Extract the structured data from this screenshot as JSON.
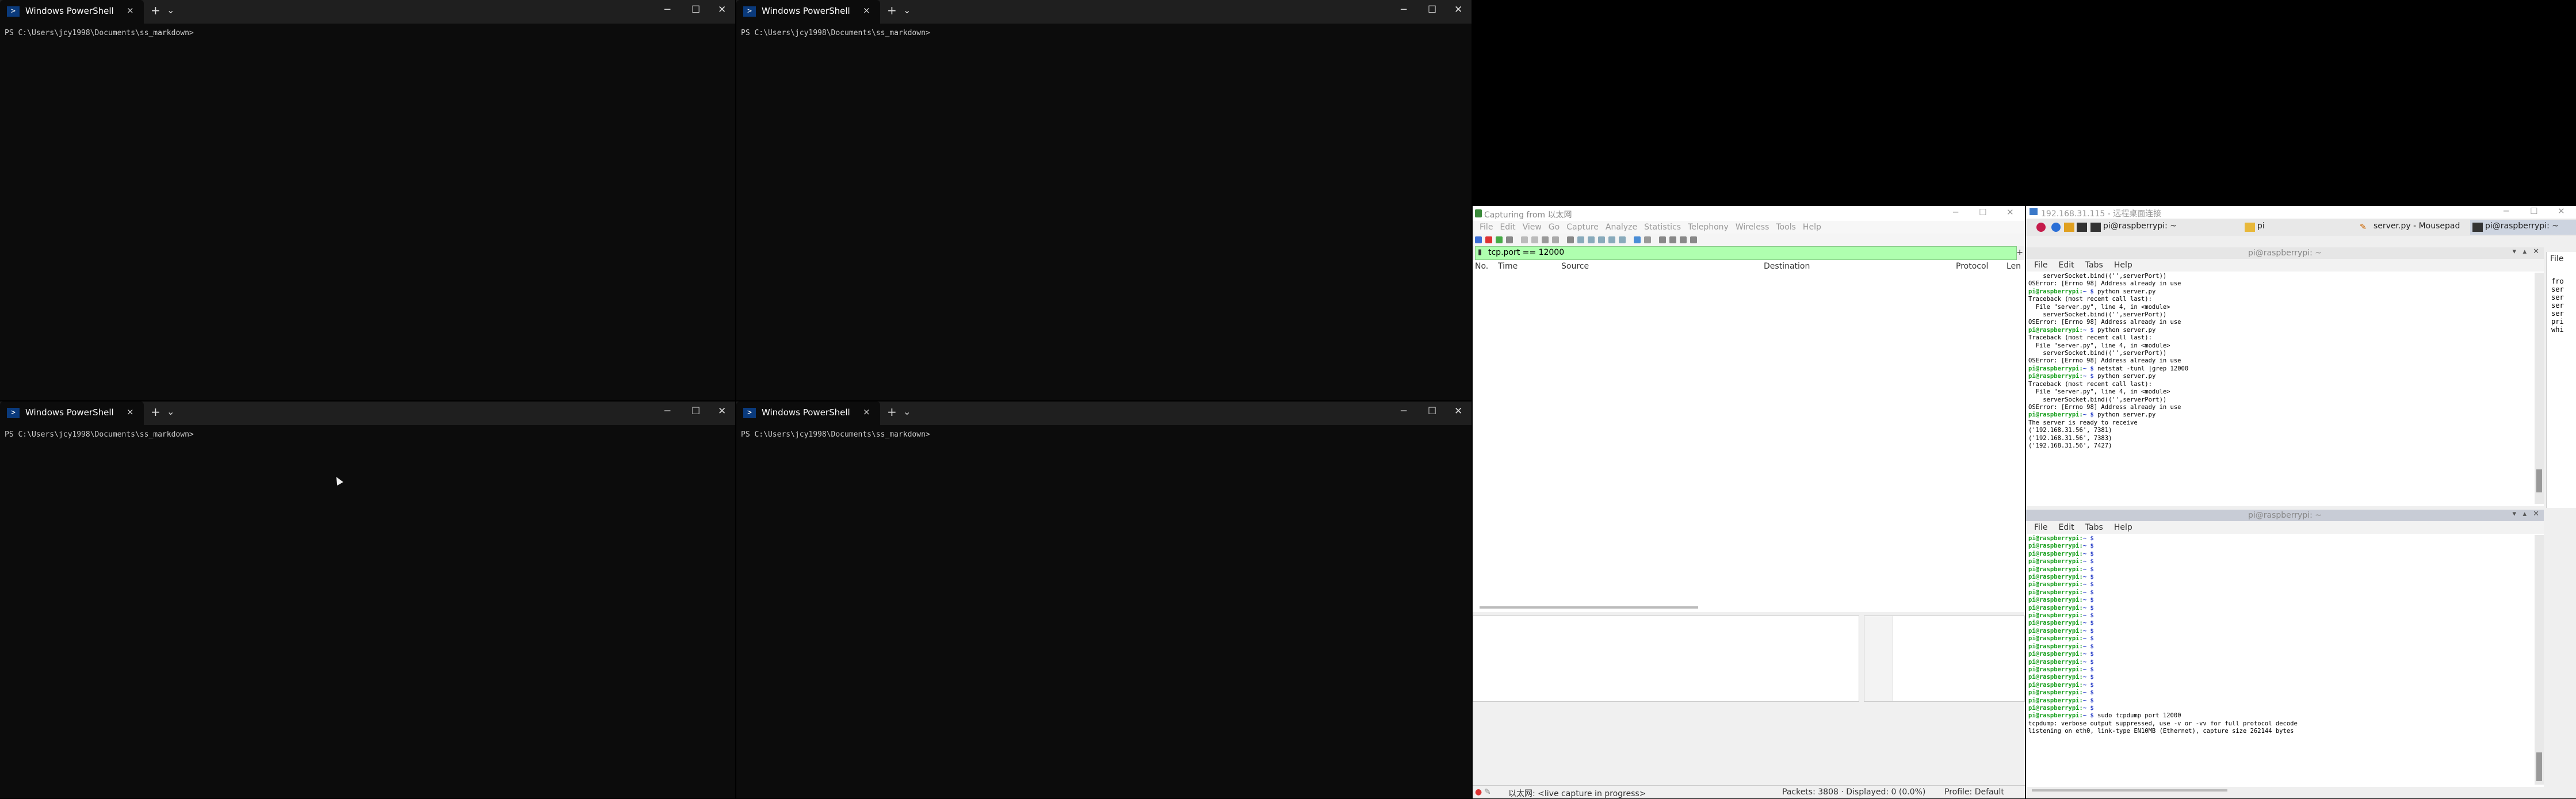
{
  "powershell": {
    "tab_label": "Windows PowerShell",
    "prompt": "PS C:\\Users\\jcy1998\\Documents\\ss_markdown>",
    "plus": "+",
    "dropdown": "⌄",
    "close": "×",
    "minimize": "─",
    "maximize": "☐",
    "close_window": "✕"
  },
  "wireshark": {
    "title": "Capturing from 以太网",
    "menu": [
      "File",
      "Edit",
      "View",
      "Go",
      "Capture",
      "Analyze",
      "Statistics",
      "Telephony",
      "Wireless",
      "Tools",
      "Help"
    ],
    "filter": "tcp.port == 12000",
    "columns": [
      "No.",
      "Time",
      "Source",
      "Destination",
      "Protocol",
      "Len"
    ],
    "status_iface": "以太网: <live capture in progress>",
    "status_packets": "Packets: 3808 · Displayed: 0 (0.0%)",
    "status_profile": "Profile: Default"
  },
  "remote": {
    "title": "192.168.31.115 - 远程桌面连接",
    "panel": [
      "pi@raspberrypi: ~",
      "pi",
      "server.py - Mousepad",
      "pi@raspberrypi: ~"
    ],
    "term1_title": "pi@raspberrypi: ~",
    "term2_title": "pi@raspberrypi: ~",
    "term_menu": [
      "File",
      "Edit",
      "Tabs",
      "Help"
    ],
    "right_menu": "File",
    "right_snippet": "fro\nser\nser\nser\nser\npri\nwhi",
    "term1_lines": [
      {
        "t": "    serverSocket.bind(('',serverPort))"
      },
      {
        "t": "OSError: [Errno 98] Address already in use"
      },
      {
        "p": "pi@raspberrypi:~ $ ",
        "t": "python server.py"
      },
      {
        "t": "Traceback (most recent call last):"
      },
      {
        "t": "  File \"server.py\", line 4, in <module>"
      },
      {
        "t": "    serverSocket.bind(('',serverPort))"
      },
      {
        "t": "OSError: [Errno 98] Address already in use"
      },
      {
        "p": "pi@raspberrypi:~ $ ",
        "t": "python server.py"
      },
      {
        "t": "Traceback (most recent call last):"
      },
      {
        "t": "  File \"server.py\", line 4, in <module>"
      },
      {
        "t": "    serverSocket.bind(('',serverPort))"
      },
      {
        "t": "OSError: [Errno 98] Address already in use"
      },
      {
        "p": "pi@raspberrypi:~ $ ",
        "t": "netstat -tunl |grep 12000"
      },
      {
        "p": "pi@raspberrypi:~ $ ",
        "t": "python server.py"
      },
      {
        "t": "Traceback (most recent call last):"
      },
      {
        "t": "  File \"server.py\", line 4, in <module>"
      },
      {
        "t": "    serverSocket.bind(('',serverPort))"
      },
      {
        "t": "OSError: [Errno 98] Address already in use"
      },
      {
        "p": "pi@raspberrypi:~ $ ",
        "t": "python server.py"
      },
      {
        "t": "The server is ready to receive"
      },
      {
        "t": "('192.168.31.56', 7381)"
      },
      {
        "t": "('192.168.31.56', 7383)"
      },
      {
        "t": "('192.168.31.56', 7427)"
      },
      {
        "t": ""
      }
    ],
    "term2_prompt": "pi@raspberrypi:~ $ ",
    "term2_prompt_lines": 23,
    "term2_tail": [
      {
        "p": "pi@raspberrypi:~ $ ",
        "t": "sudo tcpdump port 12000"
      },
      {
        "t": "tcpdump: verbose output suppressed, use -v or -vv for full protocol decode"
      },
      {
        "t": "listening on eth0, link-type EN10MB (Ethernet), capture size 262144 bytes"
      }
    ]
  }
}
